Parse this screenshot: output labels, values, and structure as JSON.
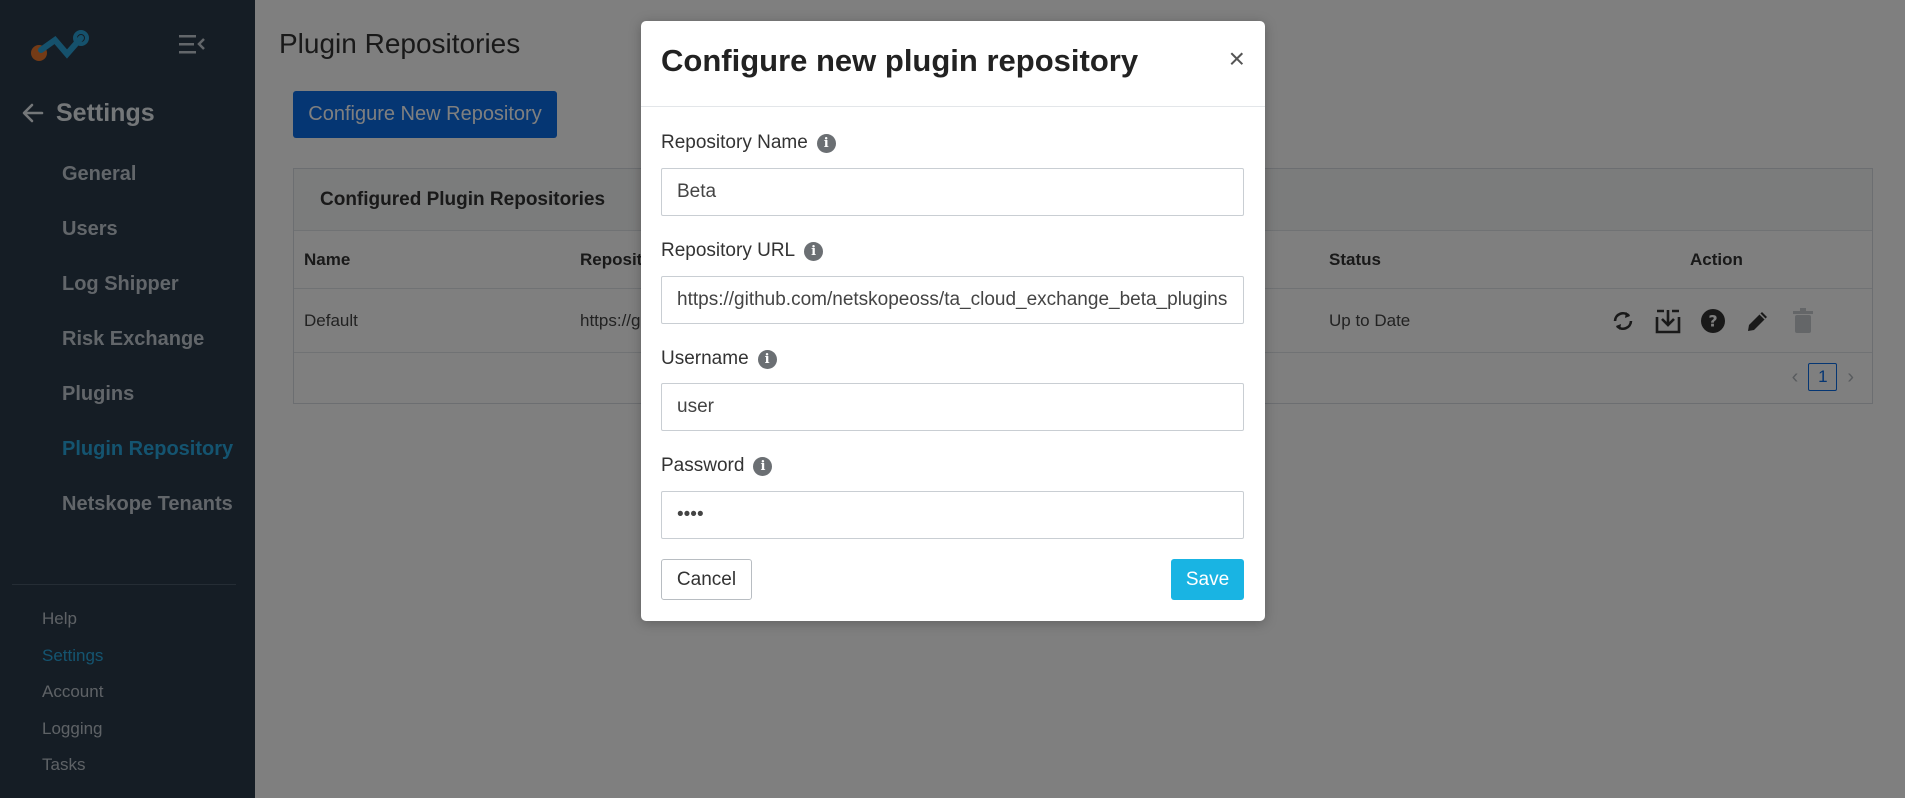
{
  "sidebar": {
    "back_label": "Settings",
    "nav": [
      {
        "label": "General"
      },
      {
        "label": "Users"
      },
      {
        "label": "Log Shipper"
      },
      {
        "label": "Risk Exchange"
      },
      {
        "label": "Plugins"
      },
      {
        "label": "Plugin Repository",
        "active": true
      },
      {
        "label": "Netskope Tenants"
      }
    ],
    "bottom_nav": [
      {
        "label": "Help"
      },
      {
        "label": "Settings",
        "active": true
      },
      {
        "label": "Account"
      },
      {
        "label": "Logging"
      },
      {
        "label": "Tasks"
      }
    ]
  },
  "page": {
    "title": "Plugin Repositories",
    "configure_button": "Configure New Repository",
    "card_title": "Configured Plugin Repositories",
    "columns": {
      "name": "Name",
      "repository": "Reposit",
      "status": "Status",
      "action": "Action"
    },
    "rows": [
      {
        "name": "Default",
        "repository": "https://g",
        "status": "Up to Date"
      }
    ],
    "pagination": {
      "current_page": "1"
    }
  },
  "modal": {
    "title": "Configure new plugin repository",
    "close": "×",
    "fields": {
      "repo_name": {
        "label": "Repository Name",
        "value": "Beta"
      },
      "repo_url": {
        "label": "Repository URL",
        "value": "https://github.com/netskopeoss/ta_cloud_exchange_beta_plugins"
      },
      "username": {
        "label": "Username",
        "value": "user"
      },
      "password": {
        "label": "Password",
        "value": "••••"
      }
    },
    "cancel": "Cancel",
    "save": "Save"
  },
  "colors": {
    "sidebar_bg": "#2b3a4a",
    "accent": "#29a8e0",
    "primary_button": "#0a6ce6",
    "save_button": "#19b4e3"
  },
  "icons": {
    "logo": "netskope-logo",
    "menu_toggle": "collapse-menu-icon",
    "back": "arrow-left-icon",
    "info": "info-icon",
    "actions": [
      "sync-icon",
      "download-icon",
      "help-icon",
      "edit-icon",
      "delete-icon"
    ]
  }
}
